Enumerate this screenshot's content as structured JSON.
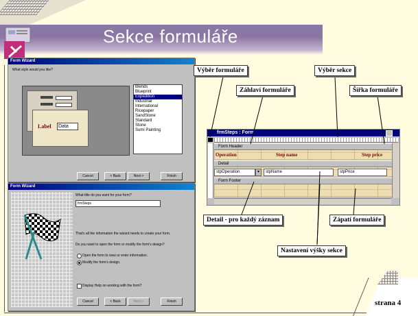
{
  "slide": {
    "title": "Sekce formuláře",
    "page_label": "strana 4"
  },
  "wizard1": {
    "title": "Form Wizard",
    "question": "What style would you like?",
    "sample_label": "Label",
    "sample_data": "Data",
    "styles": [
      "Blends",
      "Blueprint",
      "Expedition",
      "Industrial",
      "International",
      "Ricepaper",
      "SandStone",
      "Standard",
      "Stone",
      "Sumi Painting"
    ],
    "selected_style": "Expedition",
    "buttons": [
      "Cancel",
      "< Back",
      "Next >",
      "Finish"
    ]
  },
  "wizard2": {
    "title": "Form Wizard",
    "question": "What title do you want for your form?",
    "form_title_value": "frmSteps",
    "info_text": "That's all the information the wizard needs to create your form.",
    "open_question": "Do you want to open the form or modify the form's design?",
    "option_open": "Open the form to view or enter information.",
    "option_modify": "Modify the form's design.",
    "help_checkbox": "Display Help on working with the form?",
    "buttons": [
      "Cancel",
      "< Back",
      "Next >",
      "Finish"
    ]
  },
  "design_view": {
    "window_title": "frmSteps : Form",
    "band_header": "Form Header",
    "band_detail": "Detail",
    "band_footer": "Form Footer",
    "header_labels": [
      "Operation",
      "Step name",
      "Step price"
    ],
    "detail_fields": [
      "stpOperation",
      "stpName",
      "stpPrice"
    ]
  },
  "callouts": {
    "form_selector": "Výběr formuláře",
    "section_selector": "Výběr sekce",
    "form_header": "Záhlaví formuláře",
    "form_width": "Šířka formuláře",
    "detail": "Detail - pro každý záznam",
    "form_footer": "Zápatí formuláře",
    "section_height": "Nastavení výšky sekce"
  }
}
